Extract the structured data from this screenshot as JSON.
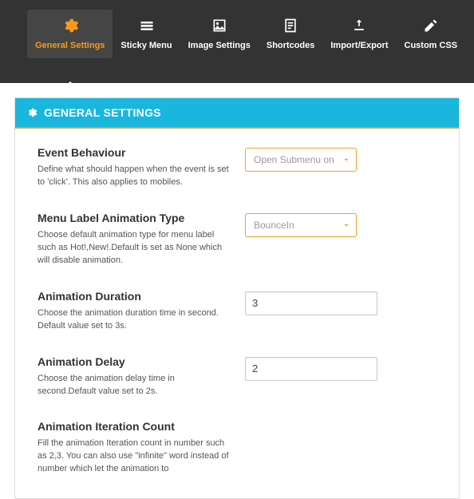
{
  "tabs": [
    {
      "label": "General Settings",
      "active": true
    },
    {
      "label": "Sticky Menu",
      "active": false
    },
    {
      "label": "Image Settings",
      "active": false
    },
    {
      "label": "Shortcodes",
      "active": false
    },
    {
      "label": "Import/Export",
      "active": false
    },
    {
      "label": "Custom CSS",
      "active": false
    }
  ],
  "panel": {
    "title": "GENERAL SETTINGS"
  },
  "fields": {
    "event_behaviour": {
      "title": "Event Behaviour",
      "desc": "Define what should happen when the event is set to 'click'. This also applies to mobiles.",
      "value": "Open Submenu on"
    },
    "label_anim_type": {
      "title": "Menu Label Animation Type",
      "desc": "Choose default animation type for menu label such as Hot!,New!.Default is set as None which will disable animation.",
      "value": "BounceIn"
    },
    "anim_duration": {
      "title": "Animation Duration",
      "desc": "Choose the animation duration time in second. Default value set to 3s.",
      "value": "3"
    },
    "anim_delay": {
      "title": "Animation Delay",
      "desc": "Choose the animation delay time in second.Default value set to 2s.",
      "value": "2"
    },
    "anim_iter": {
      "title": "Animation Iteration Count",
      "desc": "Fill the animation Iteration count in number such as 2,3. You can also use \"infinite\" word instead of number which let the animation to"
    }
  }
}
